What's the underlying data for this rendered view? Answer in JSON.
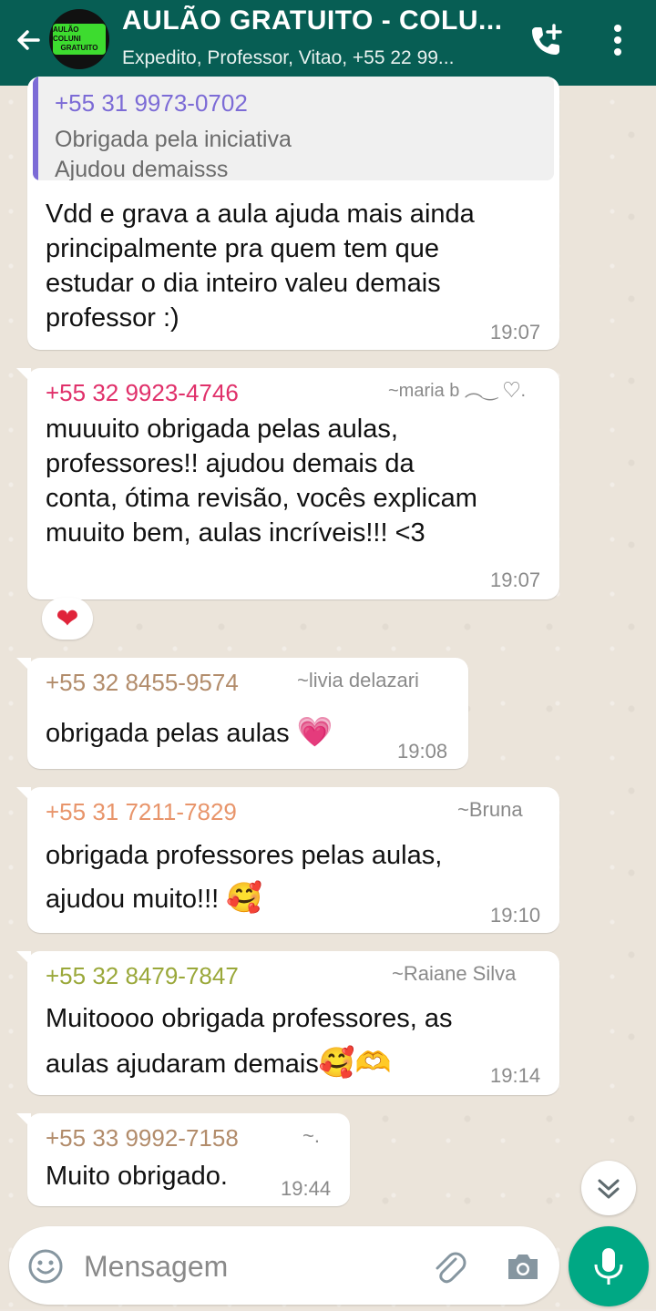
{
  "header": {
    "title": "AULÃO GRATUITO - COLU...",
    "subtitle": "Expedito, Professor, Vitao, +55 22 99...",
    "avatar_text_1": "AULÃO COLUNI",
    "avatar_text_2": "GRATUITO"
  },
  "messages": [
    {
      "quote": {
        "sender": "+55 31 9973-0702",
        "line1": "Obrigada pela iniciativa",
        "line2": "Ajudou demaisss"
      },
      "lines": [
        "Vdd e grava a aula ajuda mais ainda",
        "principalmente pra quem tem que",
        "estudar o dia inteiro valeu demais",
        "professor :)"
      ],
      "time": "19:07"
    },
    {
      "sender": "+55 32 9923-4746",
      "sender_color": "#e0306a",
      "alias": "~maria b ︵‿ ♡.",
      "lines": [
        "muuuito obrigada pelas aulas,",
        "professores!! ajudou demais da",
        "conta, ótima revisão, vocês explicam",
        "muuito bem, aulas incríveis!!! <3"
      ],
      "time": "19:07",
      "reaction": "❤"
    },
    {
      "sender": "+55 32 8455-9574",
      "sender_color": "#b28c6b",
      "alias": "~livia delazari",
      "text": "obrigada pelas aulas",
      "emoji": "💗",
      "time": "19:08"
    },
    {
      "sender": "+55 31 7211-7829",
      "sender_color": "#e8956b",
      "alias": "~Bruna",
      "lines": [
        "obrigada professores pelas aulas,",
        "ajudou muito!!!"
      ],
      "emoji": "🥰",
      "time": "19:10"
    },
    {
      "sender": "+55 32 8479-7847",
      "sender_color": "#9aa83a",
      "alias": "~Raiane Silva",
      "lines": [
        "Muitoooo obrigada professores, as",
        "aulas ajudaram demais"
      ],
      "emoji": "🥰🫶",
      "time": "19:14"
    },
    {
      "sender": "+55 33 9992-7158",
      "sender_color": "#b28c6b",
      "alias": "~.",
      "text": "Muito obrigado.",
      "time": "19:44"
    }
  ],
  "input": {
    "placeholder": "Mensagem"
  },
  "icons": {
    "back": "arrow-left-icon",
    "call": "add-call-icon",
    "menu": "more-vertical-icon",
    "scroll": "double-chevron-down-icon",
    "emoji": "smiley-icon",
    "attach": "paperclip-icon",
    "camera": "camera-icon",
    "mic": "microphone-icon"
  },
  "colors": {
    "header": "#075e54",
    "accent": "#00a884",
    "quote_bar": "#7c6bd6"
  }
}
